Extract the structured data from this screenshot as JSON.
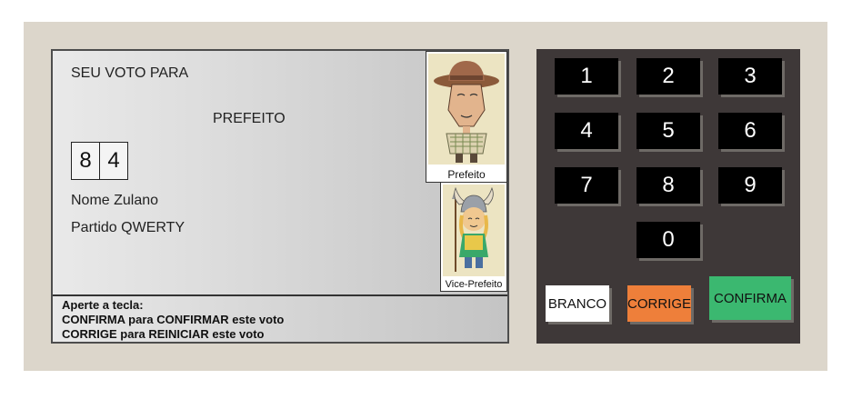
{
  "screen": {
    "title": "SEU VOTO PARA",
    "office": "PREFEITO",
    "digits": [
      "8",
      "4"
    ],
    "candidate_name": "Nome Zulano",
    "party": "Partido QWERTY",
    "photos": {
      "main_caption": "Prefeito",
      "vice_caption": "Vice-Prefeito"
    },
    "instructions": {
      "line1": "Aperte a tecla:",
      "line2": "CONFIRMA para CONFIRMAR este voto",
      "line3": "CORRIGE para REINICIAR este voto"
    }
  },
  "keypad": {
    "keys": [
      "1",
      "2",
      "3",
      "4",
      "5",
      "6",
      "7",
      "8",
      "9",
      "0"
    ],
    "branco": "BRANCO",
    "corrige": "CORRIGE",
    "confirma": "CONFIRMA"
  },
  "colors": {
    "case": "#dcd6cb",
    "keypad_panel": "#3e3838",
    "corrige": "#ee7f3a",
    "confirma": "#3bb870",
    "branco": "#ffffff"
  }
}
